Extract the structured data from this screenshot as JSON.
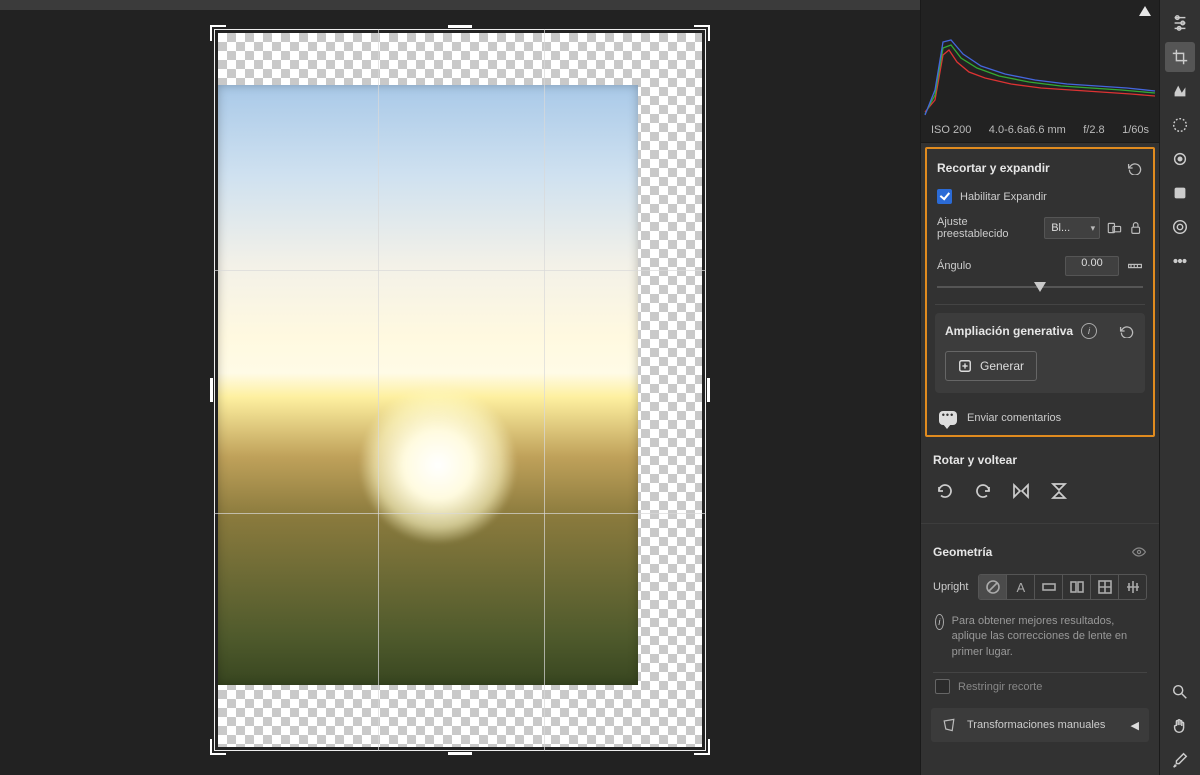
{
  "meta": {
    "iso": "ISO 200",
    "focal": "4.0-6.6a6.6 mm",
    "aperture": "f/2.8",
    "shutter": "1/60s"
  },
  "crop": {
    "title": "Recortar y expandir",
    "enable_expand": "Habilitar Expandir",
    "preset_label": "Ajuste preestablecido",
    "preset_value": "Bl...",
    "angle_label": "Ángulo",
    "angle_value": "0.00"
  },
  "gen": {
    "title": "Ampliación generativa",
    "button": "Generar"
  },
  "feedback": {
    "label": "Enviar comentarios"
  },
  "rotate": {
    "title": "Rotar y voltear"
  },
  "geometry": {
    "title": "Geometría",
    "upright": "Upright",
    "hint": "Para obtener mejores resultados, aplique las correcciones de lente en primer lugar.",
    "restrict": "Restringir recorte",
    "manual": "Transformaciones manuales"
  }
}
